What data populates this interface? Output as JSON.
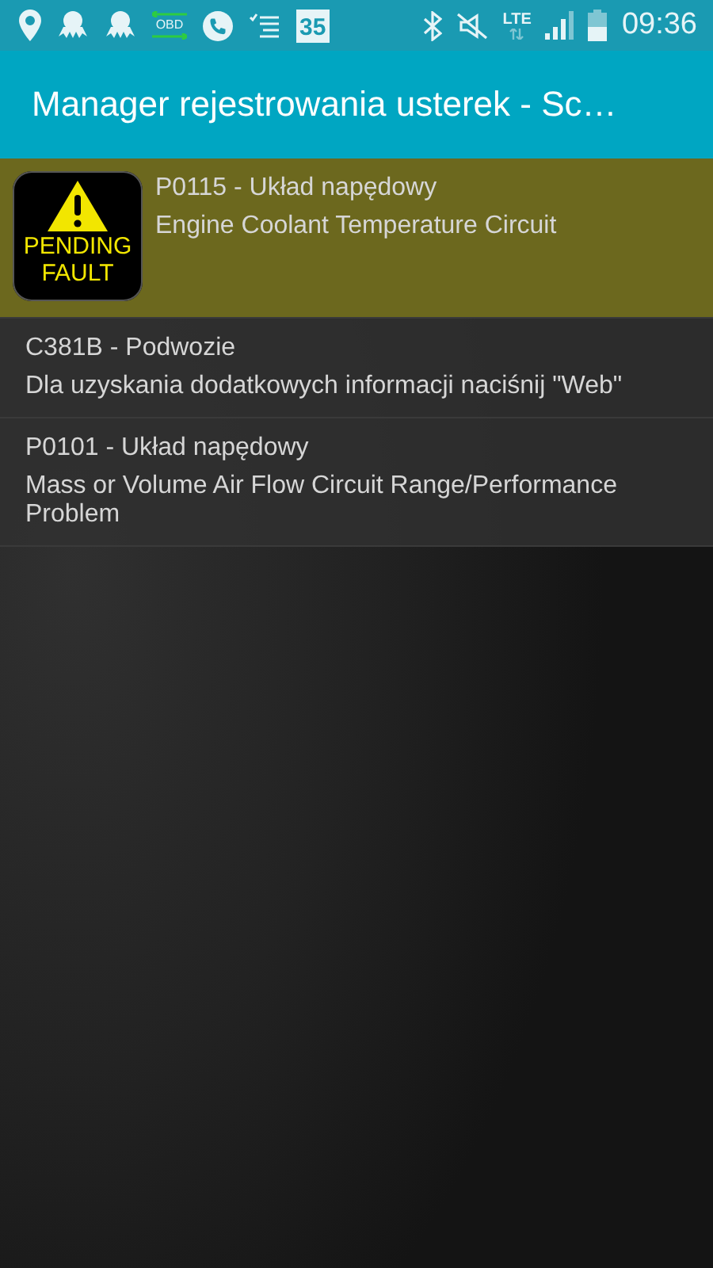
{
  "status_bar": {
    "left_icons": [
      {
        "kind": "location"
      },
      {
        "kind": "octopus"
      },
      {
        "kind": "octopus"
      },
      {
        "kind": "obd",
        "label": "OBD"
      },
      {
        "kind": "phone"
      },
      {
        "kind": "list"
      },
      {
        "kind": "calendar",
        "label": "35"
      }
    ],
    "right_icons": [
      {
        "kind": "bluetooth"
      },
      {
        "kind": "mute"
      },
      {
        "kind": "lte",
        "label": "LTE"
      },
      {
        "kind": "signal"
      },
      {
        "kind": "battery"
      }
    ],
    "time": "09:36"
  },
  "app_bar": {
    "title": "Manager rejestrowania usterek - Sc…"
  },
  "faults": [
    {
      "kind": "pending",
      "badge": [
        "PENDING",
        "FAULT"
      ],
      "code": "P0115 - Układ napędowy",
      "description": "Engine Coolant Temperature Circuit"
    },
    {
      "kind": "plain",
      "code": "C381B - Podwozie",
      "description": "Dla uzyskania dodatkowych informacji naciśnij \"Web\""
    },
    {
      "kind": "plain",
      "code": "P0101 - Układ napędowy",
      "description": "Mass or Volume Air Flow Circuit Range/Performance Problem"
    }
  ]
}
